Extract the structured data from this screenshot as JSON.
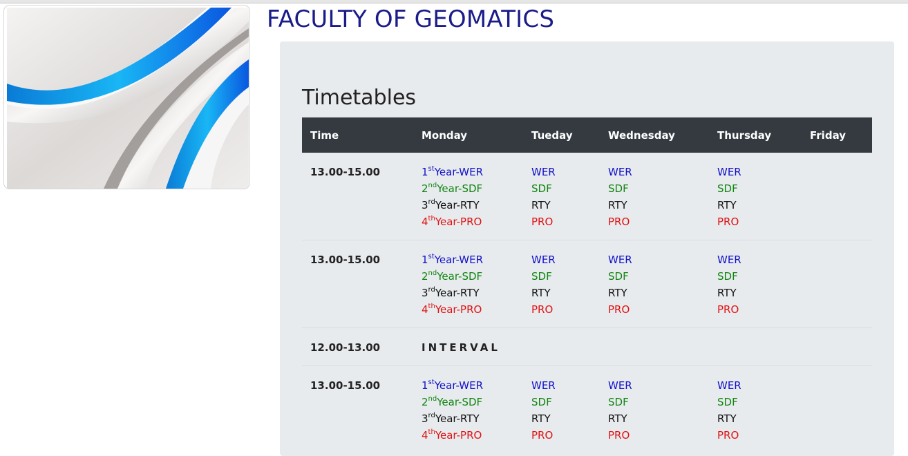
{
  "page": {
    "title": "FACULTY OF GEOMATICS",
    "section_heading": "Timetables",
    "banner_image": "abstract-blue-silver-wave"
  },
  "colors": {
    "title": "#1a1c8a",
    "header_bg": "#343a40",
    "panel_bg": "#e8ebee",
    "year1": "#1111c8",
    "year2": "#118411",
    "year3": "#111111",
    "year4": "#e01010"
  },
  "table": {
    "headers": [
      "Time",
      "Monday",
      "Tueday",
      "Wednesday",
      "Thursday",
      "Friday"
    ],
    "rows": [
      {
        "time": "13.00-15.00",
        "monday": [
          {
            "num": "1",
            "sup": "st",
            "text": "Year-WER"
          },
          {
            "num": "2",
            "sup": "nd",
            "text": "Year-SDF"
          },
          {
            "num": "3",
            "sup": "rd",
            "text": "Year-RTY"
          },
          {
            "num": "4",
            "sup": "th",
            "text": "Year-PRO"
          }
        ],
        "tuesday": [
          "WER",
          "SDF",
          "RTY",
          "PRO"
        ],
        "wednesday": [
          "WER",
          "SDF",
          "RTY",
          "PRO"
        ],
        "thursday": [
          "WER",
          "SDF",
          "RTY",
          "PRO"
        ]
      },
      {
        "time": "13.00-15.00",
        "monday": [
          {
            "num": "1",
            "sup": "st",
            "text": "Year-WER"
          },
          {
            "num": "2",
            "sup": "nd",
            "text": "Year-SDF"
          },
          {
            "num": "3",
            "sup": "rd",
            "text": "Year-RTY"
          },
          {
            "num": "4",
            "sup": "th",
            "text": "Year-PRO"
          }
        ],
        "tuesday": [
          "WER",
          "SDF",
          "RTY",
          "PRO"
        ],
        "wednesday": [
          "WER",
          "SDF",
          "RTY",
          "PRO"
        ],
        "thursday": [
          "WER",
          "SDF",
          "RTY",
          "PRO"
        ]
      },
      {
        "time": "12.00-13.00",
        "interval": "INTERVAL"
      },
      {
        "time": "13.00-15.00",
        "monday": [
          {
            "num": "1",
            "sup": "st",
            "text": "Year-WER"
          },
          {
            "num": "2",
            "sup": "nd",
            "text": "Year-SDF"
          },
          {
            "num": "3",
            "sup": "rd",
            "text": "Year-RTY"
          },
          {
            "num": "4",
            "sup": "th",
            "text": "Year-PRO"
          }
        ],
        "tuesday": [
          "WER",
          "SDF",
          "RTY",
          "PRO"
        ],
        "wednesday": [
          "WER",
          "SDF",
          "RTY",
          "PRO"
        ],
        "thursday": [
          "WER",
          "SDF",
          "RTY",
          "PRO"
        ]
      }
    ]
  }
}
